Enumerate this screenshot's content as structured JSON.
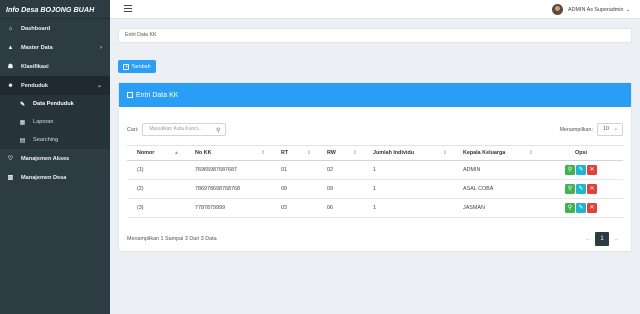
{
  "app": {
    "title": "Info Desa BOJONG BUAH"
  },
  "sidebar": {
    "items": [
      {
        "label": "Dashboard",
        "icon": "home-icon"
      },
      {
        "label": "Master Data",
        "icon": "graduation-icon"
      },
      {
        "label": "Klasifikasi",
        "icon": "users-icon"
      },
      {
        "label": "Penduduk",
        "icon": "family-icon"
      },
      {
        "label": "Manajemen Akses",
        "icon": "heart-icon"
      },
      {
        "label": "Manajemen Desa",
        "icon": "grid-icon"
      }
    ],
    "sub_items": [
      {
        "label": "Data Penduduk",
        "icon": "edit-icon"
      },
      {
        "label": "Laporan",
        "icon": "table-icon"
      },
      {
        "label": "Searching",
        "icon": "file-icon"
      }
    ]
  },
  "header": {
    "user": "ADMIN As Superadmin"
  },
  "breadcrumb": "Entri Data KK",
  "add_button": "Tambah",
  "panel": {
    "title": "Entri Data KK",
    "search_label": "Cari:",
    "search_placeholder": "Masukkan Kata Kunci...",
    "show_label": "Menampilkan:",
    "show_value": "10"
  },
  "table": {
    "headers": [
      "Nomor",
      "No KK",
      "RT",
      "RW",
      "Jumlah Individu",
      "Kepala Keluarga",
      "Opsi"
    ],
    "rows": [
      [
        "(1)",
        "76965987687687",
        "01",
        "02",
        "1",
        "ADMIN"
      ],
      [
        "(2)",
        "786978698768768",
        "09",
        "09",
        "1",
        "ASAL COBA"
      ],
      [
        "(3)",
        "7787879999",
        "03",
        "06",
        "1",
        "JASMAN"
      ]
    ]
  },
  "footer": {
    "info": "Menampilkan 1 Sampai 3 Dari 3 Data",
    "prev": "←",
    "page": "1",
    "next": "→"
  },
  "colors": {
    "primary": "#2a9df4",
    "sidebar": "#2d3c42",
    "view": "#3fb34f",
    "edit": "#21b4cf",
    "delete": "#e0413a"
  }
}
